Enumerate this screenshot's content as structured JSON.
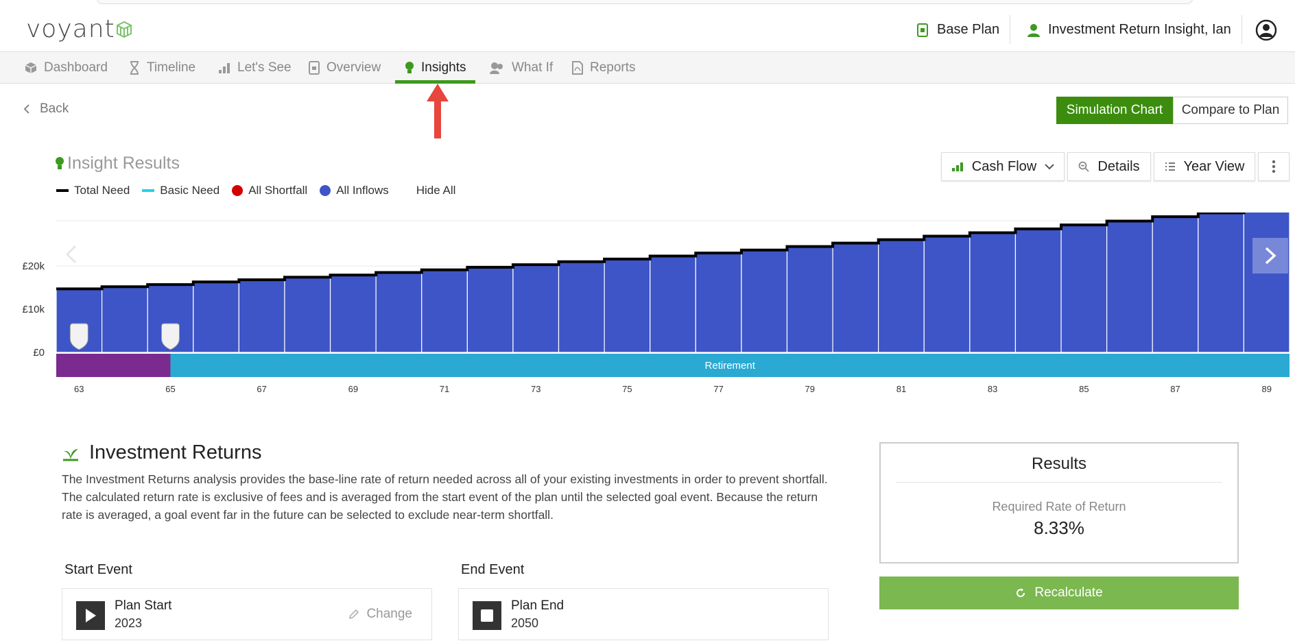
{
  "brand": {
    "logo_text": "voyant"
  },
  "header": {
    "plan_label": "Base Plan",
    "client_label": "Investment Return Insight, Ian"
  },
  "nav": {
    "tabs": [
      {
        "label": "Dashboard",
        "icon": "cube-icon",
        "active": false
      },
      {
        "label": "Timeline",
        "icon": "hourglass-icon",
        "active": false
      },
      {
        "label": "Let's See",
        "icon": "bar-chart-icon",
        "active": false
      },
      {
        "label": "Overview",
        "icon": "document-icon",
        "active": false
      },
      {
        "label": "Insights",
        "icon": "lightbulb-icon",
        "active": true
      },
      {
        "label": "What If",
        "icon": "people-icon",
        "active": false
      },
      {
        "label": "Reports",
        "icon": "pdf-icon",
        "active": false
      }
    ]
  },
  "toolbar": {
    "back_label": "Back",
    "simulation_chart_label": "Simulation Chart",
    "compare_label": "Compare to Plan",
    "cash_flow_label": "Cash Flow",
    "details_label": "Details",
    "year_view_label": "Year View"
  },
  "insight": {
    "title": "Insight Results",
    "legend": [
      {
        "label": "Total Need",
        "color": "#000000",
        "shape": "line"
      },
      {
        "label": "Basic Need",
        "color": "#22d3e6",
        "shape": "line"
      },
      {
        "label": "All Shortfall",
        "color": "#d30000",
        "shape": "dot"
      },
      {
        "label": "All Inflows",
        "color": "#3d55c7",
        "shape": "dot"
      }
    ],
    "hide_all_label": "Hide All"
  },
  "chart_data": {
    "type": "bar",
    "x": [
      63,
      64,
      65,
      66,
      67,
      68,
      69,
      70,
      71,
      72,
      73,
      74,
      75,
      76,
      77,
      78,
      79,
      80,
      81,
      82,
      83,
      84,
      85,
      86,
      87,
      88,
      89
    ],
    "series": [
      {
        "name": "All Inflows",
        "color": "#3d55c7",
        "values": [
          14700,
          15200,
          15700,
          16300,
          16800,
          17400,
          17900,
          18500,
          19100,
          19700,
          20300,
          21000,
          21600,
          22300,
          23000,
          23700,
          24500,
          25300,
          26100,
          26900,
          27700,
          28600,
          29500,
          30400,
          31400,
          32300,
          33300
        ]
      },
      {
        "name": "Total Need",
        "color": "#000000",
        "values": [
          14700,
          15200,
          15700,
          16300,
          16800,
          17400,
          17900,
          18500,
          19100,
          19700,
          20300,
          21000,
          21600,
          22300,
          23000,
          23700,
          24500,
          25300,
          26100,
          26900,
          27700,
          28600,
          29500,
          30400,
          31400,
          32300,
          33300
        ]
      }
    ],
    "y_ticks": [
      "£0",
      "£10k",
      "£20k"
    ],
    "x_ticks": [
      "63",
      "65",
      "67",
      "69",
      "71",
      "73",
      "75",
      "77",
      "79",
      "81",
      "83",
      "85",
      "87",
      "89"
    ],
    "ylim": [
      0,
      30000
    ],
    "markers_at_age": [
      63,
      65
    ],
    "phases": [
      {
        "label": "",
        "start": 63,
        "end": 65,
        "color": "#7b2a8f"
      },
      {
        "label": "Retirement",
        "start": 65,
        "end": 90,
        "color": "#2aa9d2"
      }
    ],
    "grid": true
  },
  "analysis": {
    "title": "Investment Returns",
    "description": "The Investment Returns analysis provides the base-line rate of return needed across all of your existing investments in order to prevent shortfall. The calculated return rate is exclusive of fees and is averaged from the start event of the plan until the selected goal event. Because the return rate is averaged, a goal event far in the future can be selected to exclude near-term shortfall.",
    "start_event_label": "Start Event",
    "start_event": {
      "name": "Plan Start",
      "year": "2023",
      "change_label": "Change"
    },
    "end_event_label": "End Event",
    "end_event": {
      "name": "Plan End",
      "year": "2050"
    }
  },
  "results": {
    "title": "Results",
    "metric_label": "Required Rate of Return",
    "metric_value": "8.33%",
    "recalculate_label": "Recalculate"
  }
}
